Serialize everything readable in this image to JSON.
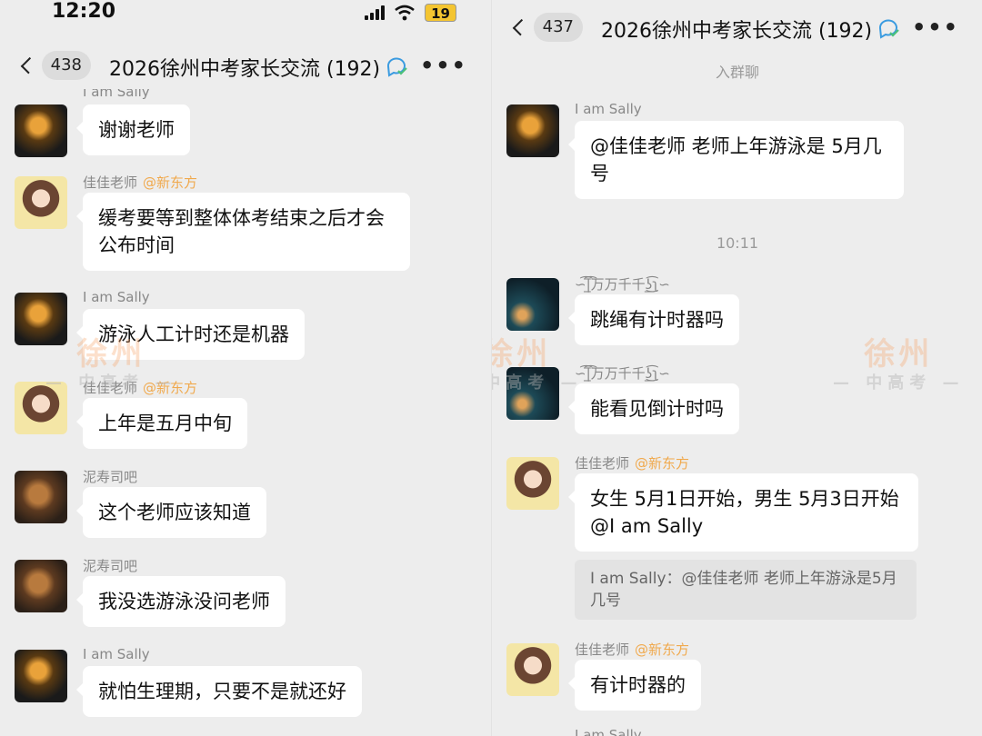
{
  "left": {
    "status": {
      "time": "12:20",
      "battery": "19"
    },
    "nav": {
      "unread": "438",
      "title": "2026徐州中考家长交流 (192)"
    },
    "partial_top_sender": "I am Sally",
    "messages": [
      {
        "sender": "",
        "tag": "",
        "text": "谢谢老师"
      },
      {
        "sender": "佳佳老师",
        "tag": "@新东方",
        "text": "缓考要等到整体体考结束之后才会公布时间"
      },
      {
        "sender": "I am Sally",
        "tag": "",
        "text": "游泳人工计时还是机器"
      },
      {
        "sender": "佳佳老师",
        "tag": "@新东方",
        "text": "上年是五月中旬"
      },
      {
        "sender": "泥寿司吧",
        "tag": "",
        "text": "这个老师应该知道"
      },
      {
        "sender": "泥寿司吧",
        "tag": "",
        "text": "我没选游泳没问老师"
      },
      {
        "sender": "I am Sally",
        "tag": "",
        "text": "就怕生理期，只要不是就还好"
      }
    ]
  },
  "right": {
    "nav": {
      "unread": "437",
      "title": "2026徐州中考家长交流 (192)"
    },
    "system_join": "入群聊",
    "time_divider": "10:11",
    "messages": [
      {
        "sender": "I am Sally",
        "tag": "",
        "text": "@佳佳老师 老师上年游泳是 5月几号"
      },
      {
        "sender": "∽͡|̲̅͡万万千千ʖ̲͜͡ʅ∽",
        "tag": "",
        "text": "跳绳有计时器吗"
      },
      {
        "sender": "∽͡|̲̅͡万万千千ʖ̲͜͡ʅ∽",
        "tag": "",
        "text": "能看见倒计时吗"
      },
      {
        "sender": "佳佳老师",
        "tag": "@新东方",
        "text": "女生 5月1日开始，男生 5月3日开始 @I am Sally"
      },
      {
        "sender": "佳佳老师",
        "tag": "@新东方",
        "text": "有计时器的"
      }
    ],
    "quote": "I am Sally：@佳佳老师 老师上年游泳是5月几号",
    "partial_bottom_sender": "I am Sally"
  },
  "watermark": {
    "big": "徐州",
    "small": "— 中高考 —"
  },
  "icons": {
    "back": "chevron-left-icon",
    "more": "more-dots-icon",
    "title_badge": "group-chat-icon",
    "signal": "signal-icon",
    "wifi": "wifi-icon",
    "battery": "battery-icon"
  },
  "colors": {
    "background": "#ededed",
    "bubble": "#ffffff",
    "tag": "#f0a94d",
    "sender": "#888888",
    "quote_bg": "#e3e3e3",
    "battery": "#f4c531"
  }
}
